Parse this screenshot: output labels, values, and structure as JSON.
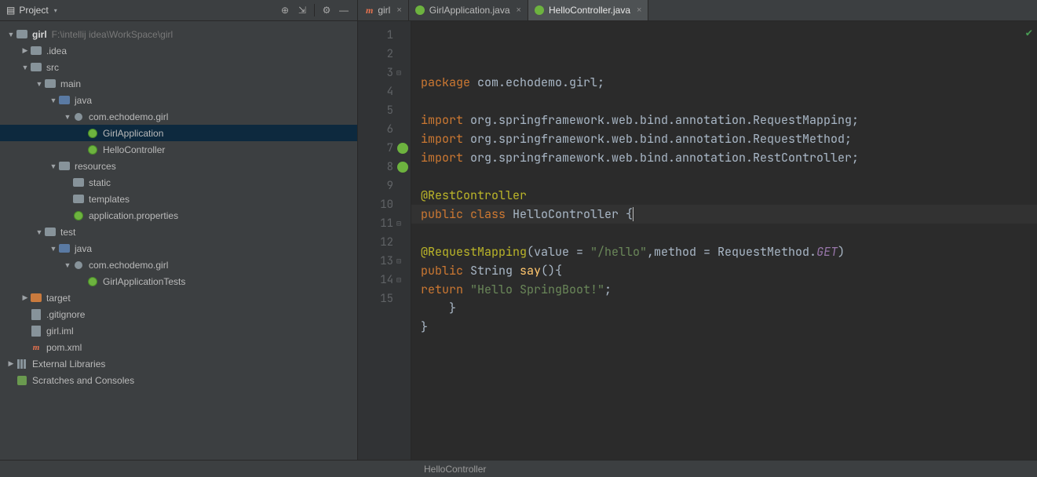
{
  "sidebar": {
    "title": "Project",
    "toolbar_icons": [
      "target-icon",
      "expand-icon",
      "divider",
      "gear-icon",
      "minimize-icon"
    ],
    "tree": [
      {
        "depth": 0,
        "arrow": "down",
        "icon": "folder",
        "label": "girl",
        "hint": "F:\\intellij idea\\WorkSpace\\girl",
        "bold": true
      },
      {
        "depth": 1,
        "arrow": "right",
        "icon": "folder",
        "label": ".idea"
      },
      {
        "depth": 1,
        "arrow": "down",
        "icon": "folder",
        "label": "src"
      },
      {
        "depth": 2,
        "arrow": "down",
        "icon": "folder",
        "label": "main"
      },
      {
        "depth": 3,
        "arrow": "down",
        "icon": "folder-blue",
        "label": "java"
      },
      {
        "depth": 4,
        "arrow": "down",
        "icon": "pkg",
        "label": "com.echodemo.girl"
      },
      {
        "depth": 5,
        "arrow": "none",
        "icon": "spring",
        "label": "GirlApplication",
        "selected": true
      },
      {
        "depth": 5,
        "arrow": "none",
        "icon": "spring",
        "label": "HelloController"
      },
      {
        "depth": 3,
        "arrow": "down",
        "icon": "folder",
        "label": "resources"
      },
      {
        "depth": 4,
        "arrow": "none",
        "icon": "folder",
        "label": "static"
      },
      {
        "depth": 4,
        "arrow": "none",
        "icon": "folder",
        "label": "templates"
      },
      {
        "depth": 4,
        "arrow": "none",
        "icon": "spring",
        "label": "application.properties"
      },
      {
        "depth": 2,
        "arrow": "down",
        "icon": "folder",
        "label": "test"
      },
      {
        "depth": 3,
        "arrow": "down",
        "icon": "folder-blue",
        "label": "java"
      },
      {
        "depth": 4,
        "arrow": "down",
        "icon": "pkg",
        "label": "com.echodemo.girl"
      },
      {
        "depth": 5,
        "arrow": "none",
        "icon": "spring",
        "label": "GirlApplicationTests"
      },
      {
        "depth": 1,
        "arrow": "right",
        "icon": "folder-orange",
        "label": "target"
      },
      {
        "depth": 1,
        "arrow": "none",
        "icon": "file",
        "label": ".gitignore"
      },
      {
        "depth": 1,
        "arrow": "none",
        "icon": "file",
        "label": "girl.iml"
      },
      {
        "depth": 1,
        "arrow": "none",
        "icon": "maven",
        "label": "pom.xml"
      },
      {
        "depth": 0,
        "arrow": "right",
        "icon": "libs",
        "label": "External Libraries"
      },
      {
        "depth": 0,
        "arrow": "none",
        "icon": "scratches",
        "label": "Scratches and Consoles"
      }
    ]
  },
  "tabs": [
    {
      "icon": "maven",
      "label": "girl",
      "active": false
    },
    {
      "icon": "spring",
      "label": "GirlApplication.java",
      "active": false
    },
    {
      "icon": "spring",
      "label": "HelloController.java",
      "active": true
    }
  ],
  "editor": {
    "lines": [
      "1",
      "2",
      "3",
      "4",
      "5",
      "6",
      "7",
      "8",
      "9",
      "10",
      "11",
      "12",
      "13",
      "14",
      "15"
    ],
    "gutterMarks": {
      "7": "green",
      "8": "green",
      "3": "fold",
      "11": "fold",
      "13": "fold",
      "14": "fold"
    },
    "code": {
      "l1": {
        "kw": "package ",
        "txt": "com.echodemo.girl;"
      },
      "l3": {
        "kw": "import ",
        "txt": "org.springframework.web.bind.annotation.RequestMapping;"
      },
      "l4": {
        "kw": "import ",
        "txt": "org.springframework.web.bind.annotation.RequestMethod;"
      },
      "l5": {
        "kw": "import ",
        "txt": "org.springframework.web.bind.annotation.RestController;"
      },
      "l7": {
        "ann": "@RestController"
      },
      "l8": {
        "kw": "public class ",
        "name": "HelloController ",
        "brace": "{"
      },
      "l10": {
        "indent": "    ",
        "ann": "@RequestMapping",
        "paren": "(value = ",
        "str1": "\"/hello\"",
        "mid": ",method = RequestMethod.",
        "getI": "GET",
        "end": ")"
      },
      "l11": {
        "indent": "    ",
        "kw": "public ",
        "type": "String ",
        "fn": "say",
        "rest": "(){"
      },
      "l12": {
        "indent": "        ",
        "kw": "return ",
        "str": "\"Hello SpringBoot!\"",
        "semi": ";"
      },
      "l13": {
        "indent": "    ",
        "brace": "}"
      },
      "l14": {
        "brace": "}"
      }
    }
  },
  "breadcrumb": "HelloController"
}
